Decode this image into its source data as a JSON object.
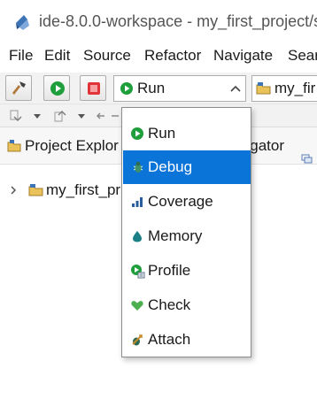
{
  "window": {
    "title": "ide-8.0.0-workspace - my_first_project/s"
  },
  "menu": [
    {
      "label": "File"
    },
    {
      "label": "Edit"
    },
    {
      "label": "Source"
    },
    {
      "label": "Refactor"
    },
    {
      "label": "Navigate"
    },
    {
      "label": "Sear"
    }
  ],
  "toolbar": {
    "buttons": [
      {
        "icon": "hammer-icon"
      },
      {
        "icon": "run-icon"
      },
      {
        "icon": "stop-icon"
      }
    ],
    "launch_mode": {
      "label": "Run",
      "icon": "run-icon"
    },
    "launch_config": {
      "label": "my_fir",
      "icon": "project-folder-icon"
    }
  },
  "views": {
    "project_explorer_tab": "Project Explor",
    "navigator_tab": "vigator"
  },
  "tree": {
    "project": "my_first_pr"
  },
  "dropdown": {
    "selected_index": 1,
    "items": [
      {
        "label": "Run",
        "icon": "run-icon"
      },
      {
        "label": "Debug",
        "icon": "debug-icon"
      },
      {
        "label": "Coverage",
        "icon": "coverage-icon"
      },
      {
        "label": "Memory",
        "icon": "memory-icon"
      },
      {
        "label": "Profile",
        "icon": "profile-icon"
      },
      {
        "label": "Check",
        "icon": "check-icon"
      },
      {
        "label": "Attach",
        "icon": "attach-icon"
      }
    ]
  },
  "colors": {
    "selection": "#0a74d8",
    "run_green": "#1f9e3c",
    "stop_red": "#e0343a",
    "folder_yellow": "#e9c25a"
  }
}
